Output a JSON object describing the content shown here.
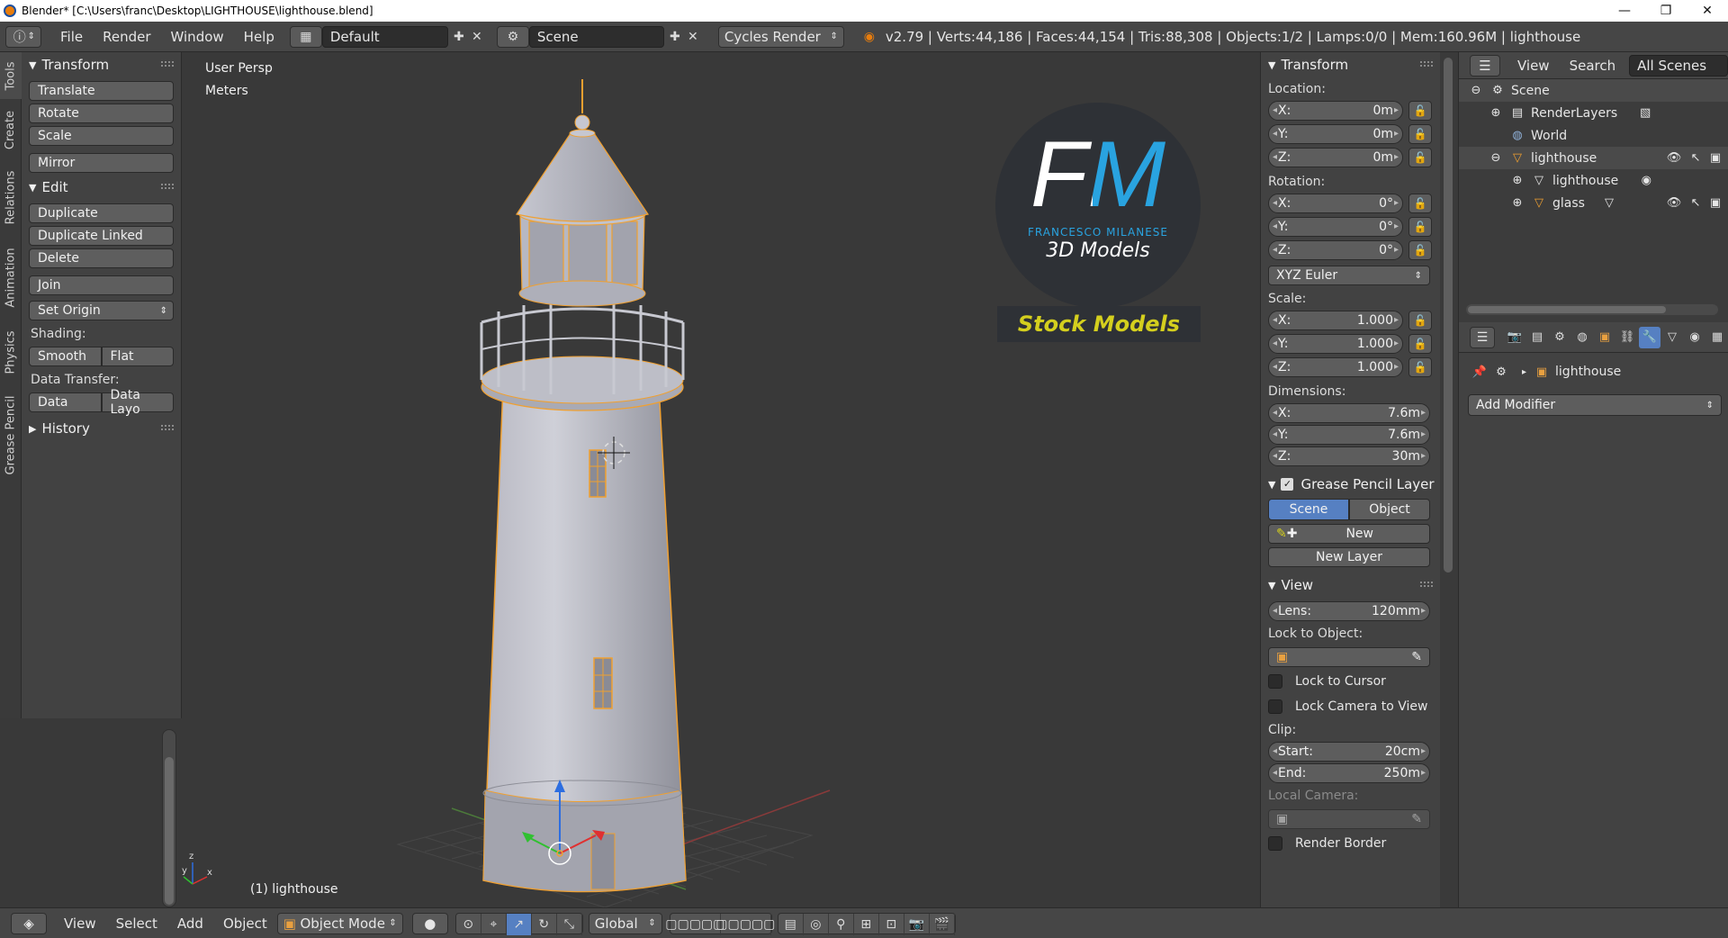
{
  "window": {
    "title": "Blender* [C:\\Users\\franc\\Desktop\\LIGHTHOUSE\\lighthouse.blend]",
    "minimize": "—",
    "restore": "❐",
    "close": "✕"
  },
  "info_header": {
    "menus": [
      "File",
      "Render",
      "Window",
      "Help"
    ],
    "layout": "Default",
    "scene": "Scene",
    "engine": "Cycles Render",
    "stats": "v2.79 | Verts:44,186 | Faces:44,154 | Tris:88,308 | Objects:1/2 | Lamps:0/0 | Mem:160.96M | lighthouse"
  },
  "tool_tabs": [
    "Tools",
    "Create",
    "Relations",
    "Animation",
    "Physics",
    "Grease Pencil"
  ],
  "tool_shelf": {
    "transform": {
      "title": "Transform",
      "buttons": [
        "Translate",
        "Rotate",
        "Scale",
        "Mirror"
      ]
    },
    "edit": {
      "title": "Edit",
      "buttons": [
        "Duplicate",
        "Duplicate Linked",
        "Delete",
        "Join"
      ],
      "set_origin": "Set Origin",
      "shading_label": "Shading:",
      "smooth": "Smooth",
      "flat": "Flat",
      "data_transfer_label": "Data Transfer:",
      "data": "Data",
      "data_layout": "Data Layo"
    },
    "history": {
      "title": "History"
    }
  },
  "viewport": {
    "view_name": "User Persp",
    "units": "Meters",
    "object_label": "(1) lighthouse",
    "logo": {
      "initials": "FM",
      "author": "FRANCESCO MILANESE",
      "tagline": "3D Models",
      "banner": "Stock Models"
    }
  },
  "n_panel": {
    "transform_title": "Transform",
    "location_label": "Location:",
    "location": [
      {
        "axis": "X:",
        "value": "0m"
      },
      {
        "axis": "Y:",
        "value": "0m"
      },
      {
        "axis": "Z:",
        "value": "0m"
      }
    ],
    "rotation_label": "Rotation:",
    "rotation": [
      {
        "axis": "X:",
        "value": "0°"
      },
      {
        "axis": "Y:",
        "value": "0°"
      },
      {
        "axis": "Z:",
        "value": "0°"
      }
    ],
    "rotation_mode": "XYZ Euler",
    "scale_label": "Scale:",
    "scale": [
      {
        "axis": "X:",
        "value": "1.000"
      },
      {
        "axis": "Y:",
        "value": "1.000"
      },
      {
        "axis": "Z:",
        "value": "1.000"
      }
    ],
    "dimensions_label": "Dimensions:",
    "dimensions": [
      {
        "axis": "X:",
        "value": "7.6m"
      },
      {
        "axis": "Y:",
        "value": "7.6m"
      },
      {
        "axis": "Z:",
        "value": "30m"
      }
    ],
    "grease_pencil_title": "Grease Pencil Layer",
    "gp_scene": "Scene",
    "gp_object": "Object",
    "gp_new": "New",
    "gp_new_layer": "New Layer",
    "view_title": "View",
    "lens_label": "Lens:",
    "lens_value": "120mm",
    "lock_to_object_label": "Lock to Object:",
    "lock_to_cursor": "Lock to Cursor",
    "lock_camera": "Lock Camera to View",
    "clip_label": "Clip:",
    "clip_start_label": "Start:",
    "clip_start_value": "20cm",
    "clip_end_label": "End:",
    "clip_end_value": "250m",
    "local_camera_label": "Local Camera:",
    "render_border": "Render Border"
  },
  "outliner": {
    "view": "View",
    "search": "Search",
    "filter": "All Scenes",
    "tree": {
      "scene": "Scene",
      "render_layers": "RenderLayers",
      "world": "World",
      "lighthouse_obj": "lighthouse",
      "lighthouse_mesh": "lighthouse",
      "glass": "glass"
    }
  },
  "properties": {
    "object_name": "lighthouse",
    "add_modifier": "Add Modifier"
  },
  "bottom_header": {
    "menus": [
      "View",
      "Select",
      "Add",
      "Object"
    ],
    "mode": "Object Mode",
    "orientation": "Global"
  },
  "colors": {
    "accent": "#5680c2",
    "selection": "#f0a030",
    "logo_blue": "#29a3e0",
    "banner_yellow": "#d4cf1e"
  }
}
